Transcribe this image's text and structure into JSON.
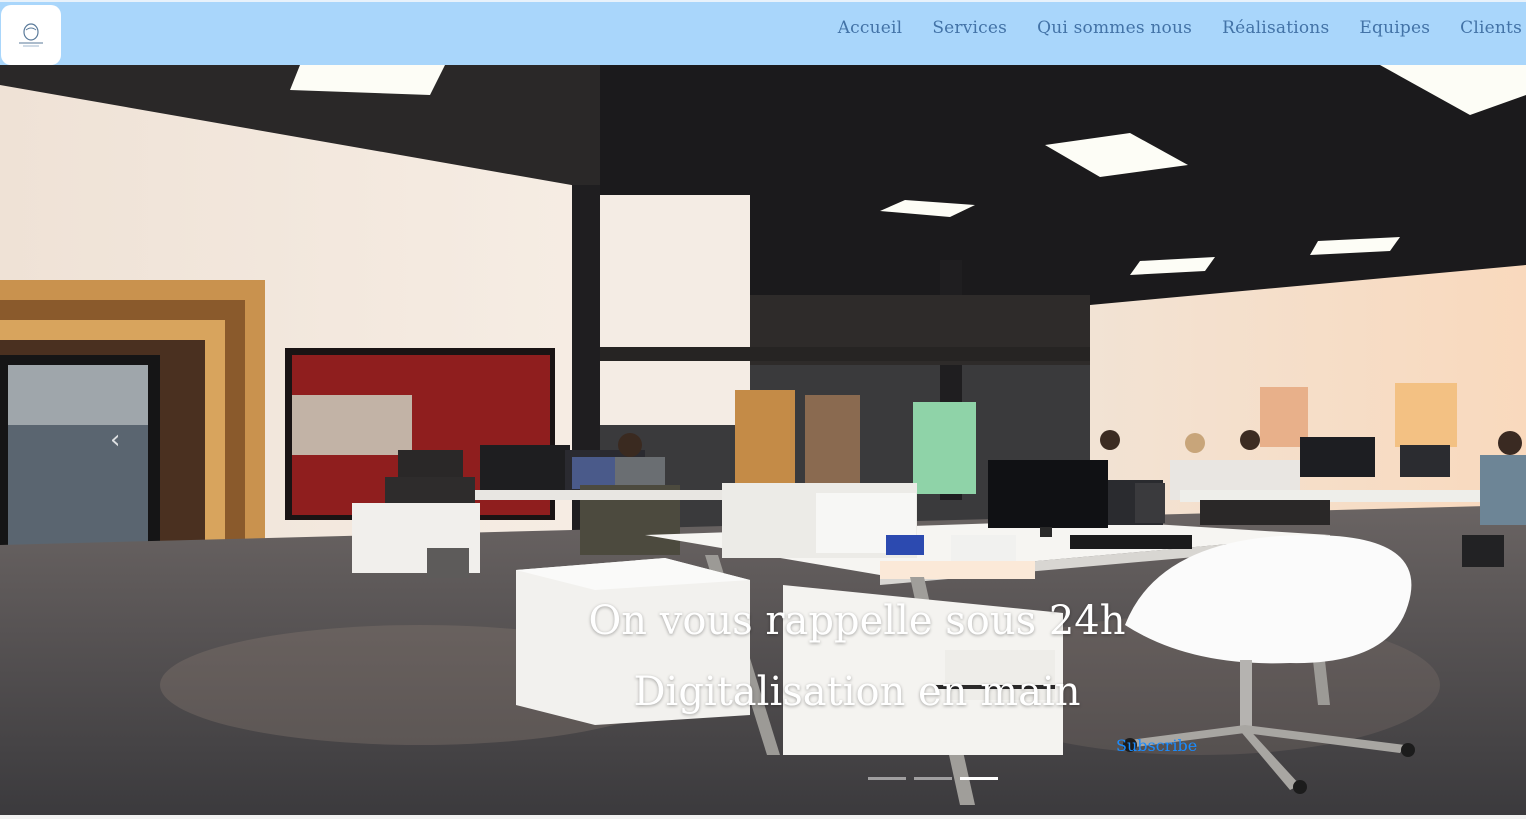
{
  "navbar": {
    "logo_icon": "logo-icon",
    "links": [
      "Accueil",
      "Services",
      "Qui sommes nous",
      "Réalisations",
      "Equipes",
      "Clients"
    ],
    "background": "#a9d6fb",
    "link_color": "#4373a7"
  },
  "hero": {
    "caption_line1": "On vous rappelle sous 24h",
    "caption_line2": "Digitalisation en main",
    "subscribe_label": "Subscribe",
    "subscribe_color": "#1a8cff",
    "prev_icon": "chevron-left-icon",
    "slides_count": 3,
    "active_slide": 3
  }
}
